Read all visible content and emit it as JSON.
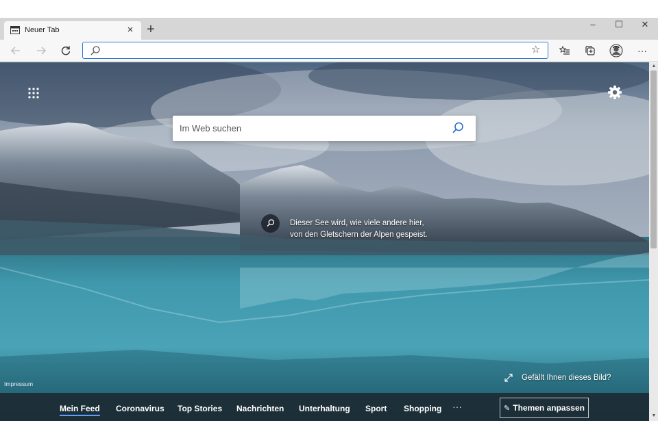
{
  "browser": {
    "tab_title": "Neuer Tab",
    "tab_close": "×",
    "new_tab": "+",
    "window_controls": {
      "minimize": "–",
      "maximize": "☐",
      "close": "✕"
    },
    "address_value": "",
    "toolbar_more": "···"
  },
  "page": {
    "search_placeholder": "Im Web suchen",
    "caption_line1": "Dieser See wird, wie viele andere hier,",
    "caption_line2": "von den Gletschern der Alpen gespeist.",
    "impressum": "Impressum",
    "like_text": "Gefällt Ihnen dieses Bild?"
  },
  "feed": {
    "items": [
      "Mein Feed",
      "Coronavirus",
      "Top Stories",
      "Nachrichten",
      "Unterhaltung",
      "Sport",
      "Shopping"
    ],
    "more": "···",
    "customize": "Themen anpassen",
    "active_index": 0
  },
  "icons": {
    "tab": "newtab-page-icon",
    "back": "back-arrow-icon",
    "forward": "forward-arrow-icon",
    "refresh": "refresh-icon",
    "search": "search-icon",
    "favorite": "star-icon",
    "favorites_list": "favorites-list-icon",
    "collections": "collections-icon",
    "profile": "profile-avatar-icon",
    "apps": "apps-grid-icon",
    "settings": "gear-icon",
    "expand": "expand-arrows-icon",
    "edit": "pencil-icon"
  },
  "colors": {
    "accent": "#3078d8",
    "feed_underline": "#5aa0ff"
  }
}
